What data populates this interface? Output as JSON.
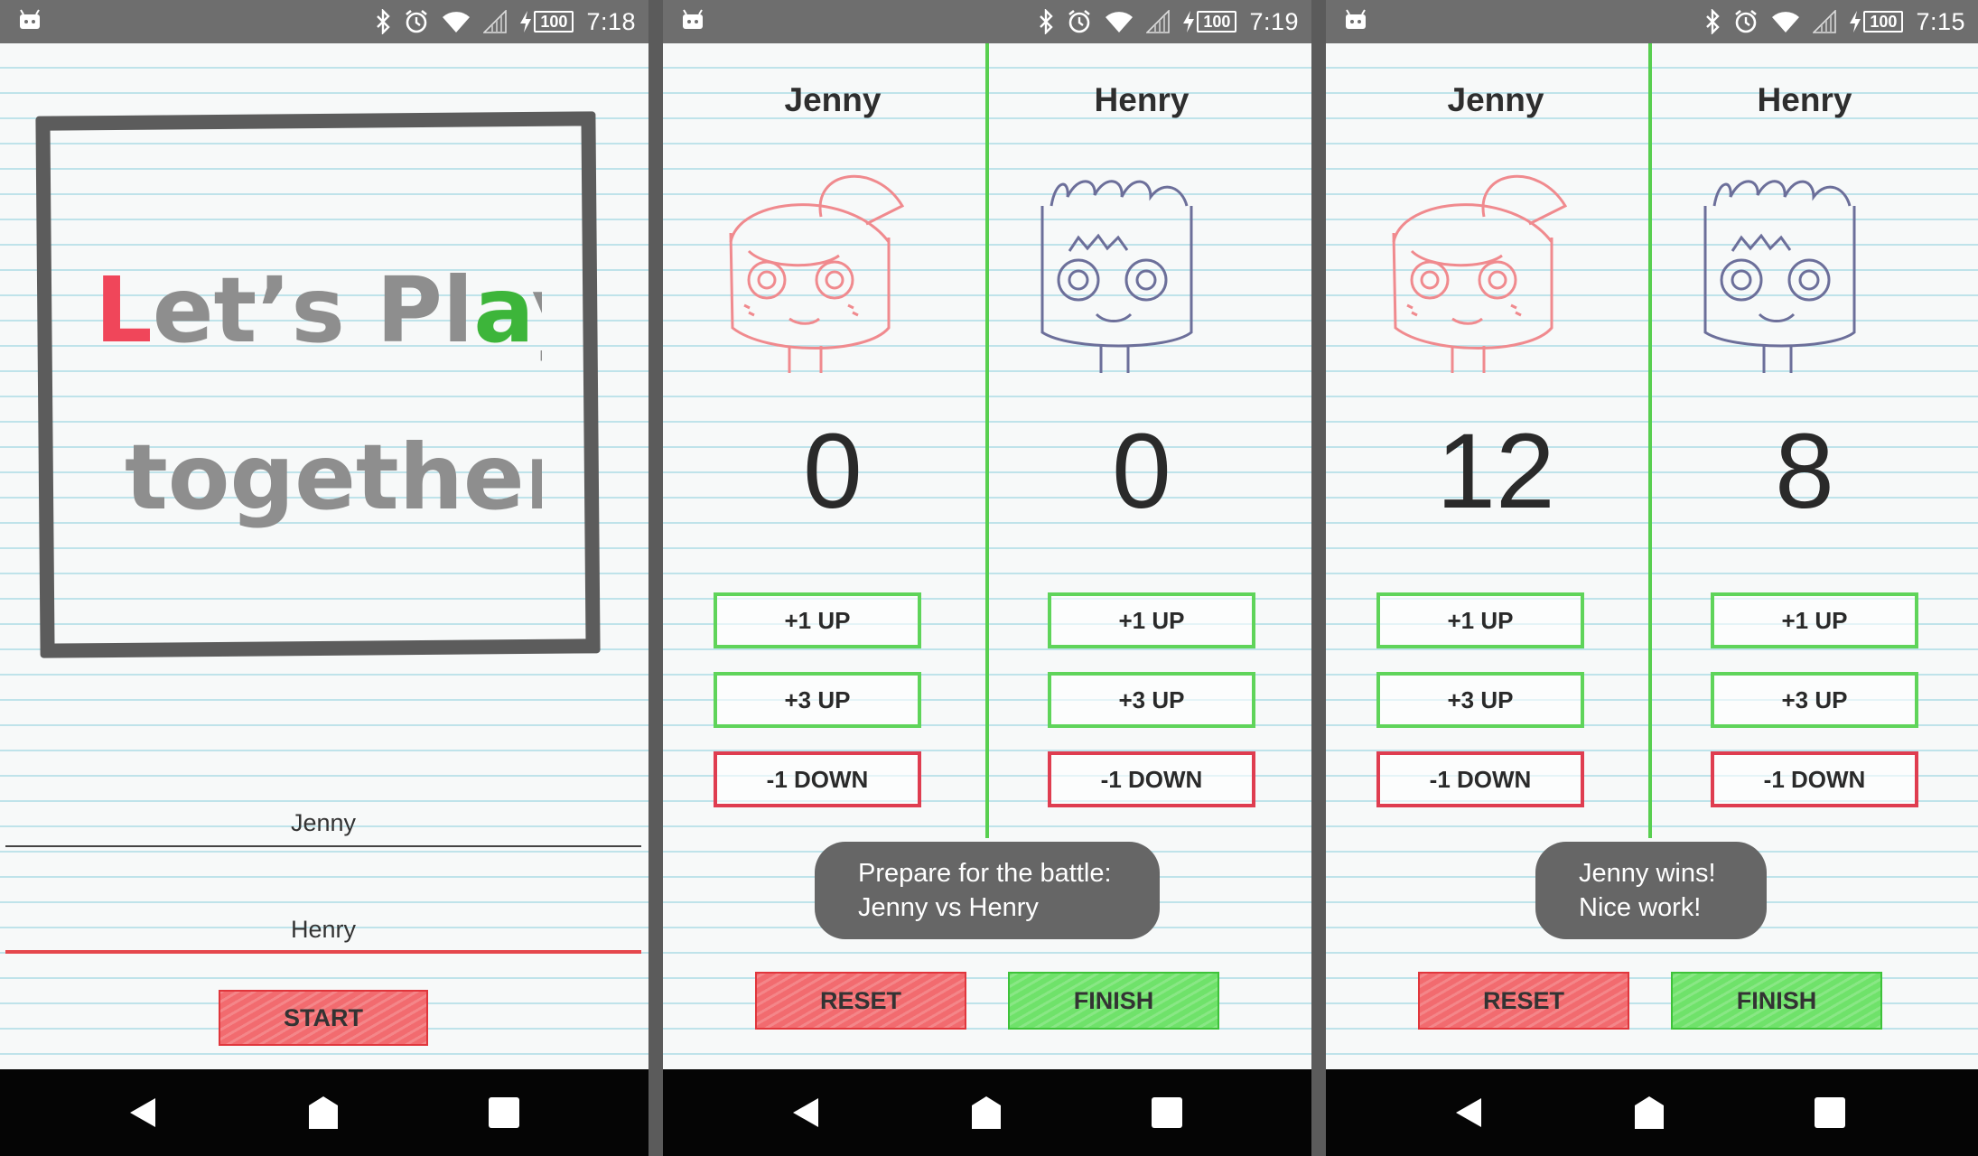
{
  "status_bars": [
    {
      "time": "7:18",
      "battery": "100"
    },
    {
      "time": "7:19",
      "battery": "100"
    },
    {
      "time": "7:15",
      "battery": "100"
    }
  ],
  "setup": {
    "title_line1": "Let's Play",
    "title_line2": "together!",
    "player1_name": "Jenny",
    "player2_name": "Henry",
    "start_label": "START"
  },
  "battle": {
    "player1": {
      "name": "Jenny",
      "score": "0"
    },
    "player2": {
      "name": "Henry",
      "score": "0"
    },
    "toast_line1": "Prepare for the battle:",
    "toast_line2": "Jenny vs Henry"
  },
  "result": {
    "player1": {
      "name": "Jenny",
      "score": "12"
    },
    "player2": {
      "name": "Henry",
      "score": "8"
    },
    "toast_line1": "Jenny wins!",
    "toast_line2": "Nice work!"
  },
  "buttons": {
    "plus1": "+1 UP",
    "plus3": "+3 UP",
    "minus1": "-1 DOWN",
    "reset": "RESET",
    "finish": "FINISH"
  },
  "colors": {
    "accent_red": "#f26b6f",
    "accent_green": "#6fe26a",
    "jenny_sketch": "#f08a8e",
    "henry_sketch": "#6c6f9a"
  }
}
